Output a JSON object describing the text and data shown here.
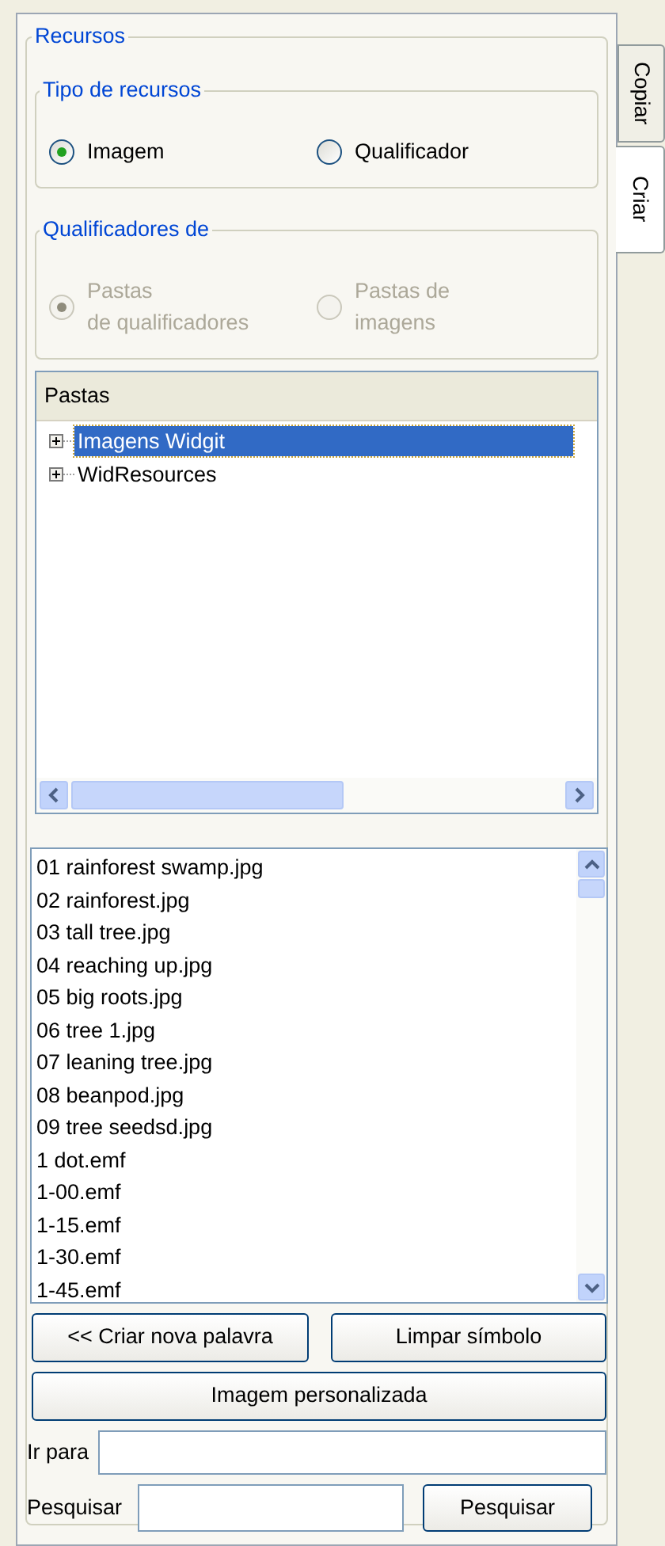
{
  "tabs": [
    {
      "label": "Copiar",
      "selected": false
    },
    {
      "label": "Criar",
      "selected": true
    }
  ],
  "resources_group": {
    "title": "Recursos"
  },
  "resource_type": {
    "title": "Tipo de recursos",
    "options": [
      {
        "label": "Imagem",
        "selected": true,
        "disabled": false
      },
      {
        "label": "Qualificador",
        "selected": false,
        "disabled": false
      }
    ]
  },
  "qualifiers_of": {
    "title": "Qualificadores de",
    "options": [
      {
        "label": "Pastas\nde qualificadores",
        "selected": true,
        "disabled": true
      },
      {
        "label": "Pastas de\nimagens",
        "selected": false,
        "disabled": true
      }
    ]
  },
  "folders": {
    "header": "Pastas",
    "items": [
      {
        "label": "Imagens Widgit",
        "selected": true,
        "expanded": false
      },
      {
        "label": "WidResources",
        "selected": false,
        "expanded": false
      }
    ]
  },
  "files": [
    "01 rainforest swamp.jpg",
    "02 rainforest.jpg",
    "03 tall tree.jpg",
    "04 reaching up.jpg",
    "05 big roots.jpg",
    "06 tree 1.jpg",
    "07 leaning tree.jpg",
    "08 beanpod.jpg",
    "09 tree seedsd.jpg",
    "1 dot.emf",
    "1-00.emf",
    "1-15.emf",
    "1-30.emf",
    "1-45.emf"
  ],
  "buttons_row": [
    "<< Criar nova palavra",
    "Limpar símbolo"
  ],
  "custom_image_button": "Imagem personalizada",
  "go_to": {
    "label": "Ir para"
  },
  "search": {
    "label": "Pesquisar",
    "button": "Pesquisar"
  }
}
